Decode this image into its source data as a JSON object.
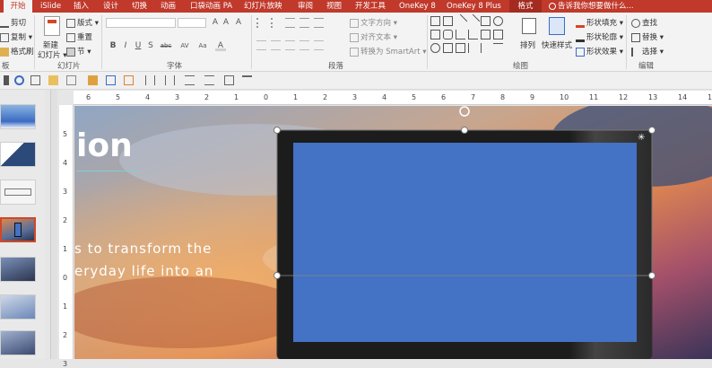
{
  "tabs": [
    "开始",
    "iSlide",
    "插入",
    "设计",
    "切换",
    "动画",
    "口袋动画 PA",
    "幻灯片放映",
    "审阅",
    "视图",
    "开发工具",
    "OneKey 8",
    "OneKey 8 Plus",
    "格式"
  ],
  "tell_me": "告诉我你想要做什么...",
  "clipboard": {
    "cut": "剪切",
    "copy": "复制",
    "format_painter": "格式刷",
    "label": "板"
  },
  "slides_group": {
    "new_slide_1": "新建",
    "new_slide_2": "幻灯片",
    "layout": "版式",
    "reset": "重置",
    "section": "节",
    "label": "幻灯片"
  },
  "font_group": {
    "bold": "B",
    "italic": "I",
    "underline": "U",
    "shadow": "S",
    "strike": "abc",
    "spacing": "AV",
    "case": "Aa",
    "label": "字体"
  },
  "paragraph_group": {
    "text_direction": "文字方向",
    "align_text": "对齐文本",
    "smartart": "转换为 SmartArt",
    "label": "段落"
  },
  "drawing_group": {
    "arrange": "排列",
    "quick_styles": "快速样式",
    "shape_fill": "形状填充",
    "shape_outline": "形状轮廓",
    "shape_effects": "形状效果",
    "label": "绘图"
  },
  "editing_group": {
    "find": "查找",
    "replace": "替换",
    "select": "选择",
    "label": "编辑"
  },
  "ruler_h": [
    "6",
    "5",
    "4",
    "3",
    "2",
    "1",
    "0",
    "1",
    "2",
    "3",
    "4",
    "5",
    "6",
    "7",
    "8",
    "9",
    "10",
    "11",
    "12",
    "13",
    "14",
    "15"
  ],
  "ruler_v": [
    "5",
    "4",
    "3",
    "2",
    "1",
    "0",
    "1",
    "2",
    "3"
  ],
  "slide": {
    "title_fragment": "ion",
    "body_line1": "s to transform the",
    "body_line2": "eryday life into an"
  },
  "colors": {
    "accent": "#c0392b",
    "screen": "#4472c4",
    "frame": "#1c1c1c"
  }
}
